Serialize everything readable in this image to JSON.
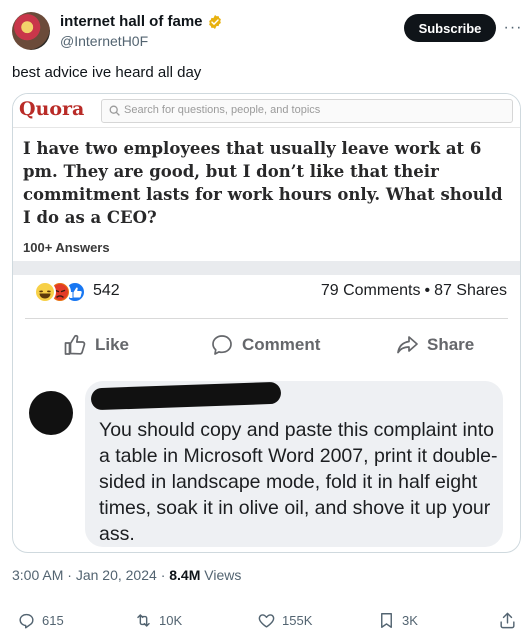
{
  "author": {
    "display_name": "internet hall of fame",
    "handle": "@InternetH0F",
    "verified_color": "#e8b10e"
  },
  "subscribe_label": "Subscribe",
  "more_label": "···",
  "tweet_text": "best advice ive heard all day",
  "media": {
    "quora": {
      "logo": "Quora",
      "search_placeholder": "Search for questions, people, and topics",
      "brand_color": "#b92b27",
      "question": "I have two employees that usually leave work at 6 pm. They are good, but I don’t like that their commitment lasts for work hours only. What should I do as a CEO?",
      "answers": "100+ Answers"
    },
    "facebook": {
      "reaction_count": "542",
      "comments": "79 Comments",
      "separator": "•",
      "shares": "87 Shares",
      "like_label": "Like",
      "comment_label": "Comment",
      "share_label": "Share",
      "comment_text": "You should copy and paste this complaint into a table in Microsoft Word 2007, print it double-sided in landscape mode, fold it in half eight times, soak it in olive oil, and shove it up your ass."
    }
  },
  "meta": {
    "time": "3:00 AM",
    "dot1": "·",
    "date": "Jan 20, 2024",
    "dot2": "·",
    "views_count": "8.4M",
    "views_label": "Views"
  },
  "stats": {
    "replies": "615",
    "reposts": "10K",
    "likes": "155K",
    "bookmarks": "3K"
  }
}
